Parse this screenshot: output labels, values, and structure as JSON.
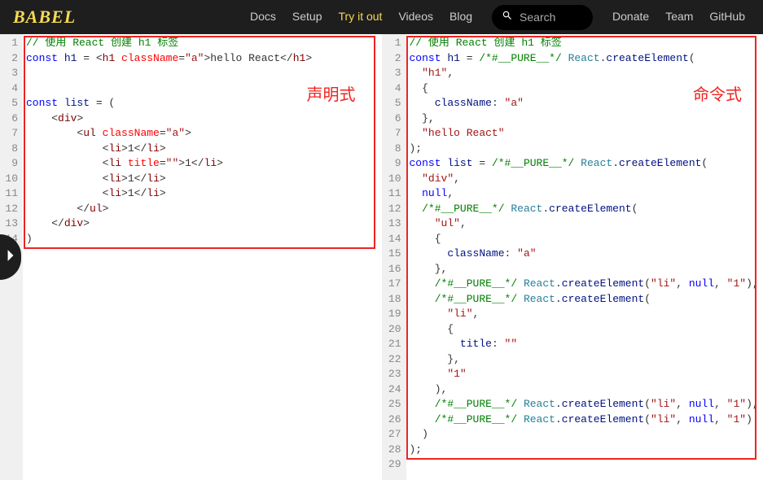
{
  "header": {
    "logo": "BABEL",
    "nav": [
      {
        "label": "Docs",
        "active": false
      },
      {
        "label": "Setup",
        "active": false
      },
      {
        "label": "Try it out",
        "active": true
      },
      {
        "label": "Videos",
        "active": false
      },
      {
        "label": "Blog",
        "active": false
      }
    ],
    "search_placeholder": "Search",
    "nav2": [
      {
        "label": "Donate"
      },
      {
        "label": "Team"
      },
      {
        "label": "GitHub"
      }
    ]
  },
  "annotations": {
    "left": "声明式",
    "right": "命令式"
  },
  "left_pane": {
    "line_count": 15,
    "lines": [
      [
        {
          "t": "// 使用 React 创建 h1 标签",
          "c": "comment"
        }
      ],
      [
        {
          "t": "const ",
          "c": "keyword"
        },
        {
          "t": "h1",
          "c": "var"
        },
        {
          "t": " = ",
          "c": "punct"
        },
        {
          "t": "<",
          "c": "punct"
        },
        {
          "t": "h1 ",
          "c": "tag"
        },
        {
          "t": "className",
          "c": "attr"
        },
        {
          "t": "=",
          "c": "punct"
        },
        {
          "t": "\"a\"",
          "c": "string"
        },
        {
          "t": ">",
          "c": "punct"
        },
        {
          "t": "hello React",
          "c": "text"
        },
        {
          "t": "</",
          "c": "punct"
        },
        {
          "t": "h1",
          "c": "tag"
        },
        {
          "t": ">",
          "c": "punct"
        }
      ],
      [],
      [],
      [
        {
          "t": "const ",
          "c": "keyword"
        },
        {
          "t": "list",
          "c": "var"
        },
        {
          "t": " = (",
          "c": "punct"
        }
      ],
      [
        {
          "t": "    ",
          "c": "punct"
        },
        {
          "t": "<",
          "c": "punct"
        },
        {
          "t": "div",
          "c": "tag"
        },
        {
          "t": ">",
          "c": "punct"
        }
      ],
      [
        {
          "t": "        ",
          "c": "punct"
        },
        {
          "t": "<",
          "c": "punct"
        },
        {
          "t": "ul ",
          "c": "tag"
        },
        {
          "t": "className",
          "c": "attr"
        },
        {
          "t": "=",
          "c": "punct"
        },
        {
          "t": "\"a\"",
          "c": "string"
        },
        {
          "t": ">",
          "c": "punct"
        }
      ],
      [
        {
          "t": "            ",
          "c": "punct"
        },
        {
          "t": "<",
          "c": "punct"
        },
        {
          "t": "li",
          "c": "tag"
        },
        {
          "t": ">",
          "c": "punct"
        },
        {
          "t": "1",
          "c": "text"
        },
        {
          "t": "</",
          "c": "punct"
        },
        {
          "t": "li",
          "c": "tag"
        },
        {
          "t": ">",
          "c": "punct"
        }
      ],
      [
        {
          "t": "            ",
          "c": "punct"
        },
        {
          "t": "<",
          "c": "punct"
        },
        {
          "t": "li ",
          "c": "tag"
        },
        {
          "t": "title",
          "c": "attr"
        },
        {
          "t": "=",
          "c": "punct"
        },
        {
          "t": "\"\"",
          "c": "string"
        },
        {
          "t": ">",
          "c": "punct"
        },
        {
          "t": "1",
          "c": "text"
        },
        {
          "t": "</",
          "c": "punct"
        },
        {
          "t": "li",
          "c": "tag"
        },
        {
          "t": ">",
          "c": "punct"
        }
      ],
      [
        {
          "t": "            ",
          "c": "punct"
        },
        {
          "t": "<",
          "c": "punct"
        },
        {
          "t": "li",
          "c": "tag"
        },
        {
          "t": ">",
          "c": "punct"
        },
        {
          "t": "1",
          "c": "text"
        },
        {
          "t": "</",
          "c": "punct"
        },
        {
          "t": "li",
          "c": "tag"
        },
        {
          "t": ">",
          "c": "punct"
        }
      ],
      [
        {
          "t": "            ",
          "c": "punct"
        },
        {
          "t": "<",
          "c": "punct"
        },
        {
          "t": "li",
          "c": "tag"
        },
        {
          "t": ">",
          "c": "punct"
        },
        {
          "t": "1",
          "c": "text"
        },
        {
          "t": "</",
          "c": "punct"
        },
        {
          "t": "li",
          "c": "tag"
        },
        {
          "t": ">",
          "c": "punct"
        }
      ],
      [
        {
          "t": "        ",
          "c": "punct"
        },
        {
          "t": "</",
          "c": "punct"
        },
        {
          "t": "ul",
          "c": "tag"
        },
        {
          "t": ">",
          "c": "punct"
        }
      ],
      [
        {
          "t": "    ",
          "c": "punct"
        },
        {
          "t": "</",
          "c": "punct"
        },
        {
          "t": "div",
          "c": "tag"
        },
        {
          "t": ">",
          "c": "punct"
        }
      ],
      [
        {
          "t": ")",
          "c": "punct"
        }
      ],
      []
    ]
  },
  "right_pane": {
    "line_count": 29,
    "lines": [
      [
        {
          "t": "// 使用 React 创建 h1 标签",
          "c": "comment"
        }
      ],
      [
        {
          "t": "const ",
          "c": "keyword"
        },
        {
          "t": "h1",
          "c": "var"
        },
        {
          "t": " = ",
          "c": "punct"
        },
        {
          "t": "/*#__PURE__*/",
          "c": "comment"
        },
        {
          "t": " ",
          "c": "punct"
        },
        {
          "t": "React",
          "c": "obj"
        },
        {
          "t": ".",
          "c": "punct"
        },
        {
          "t": "createElement",
          "c": "prop"
        },
        {
          "t": "(",
          "c": "punct"
        }
      ],
      [
        {
          "t": "  ",
          "c": "punct"
        },
        {
          "t": "\"h1\"",
          "c": "string"
        },
        {
          "t": ",",
          "c": "punct"
        }
      ],
      [
        {
          "t": "  {",
          "c": "punct"
        }
      ],
      [
        {
          "t": "    ",
          "c": "punct"
        },
        {
          "t": "className",
          "c": "prop"
        },
        {
          "t": ": ",
          "c": "punct"
        },
        {
          "t": "\"a\"",
          "c": "string"
        }
      ],
      [
        {
          "t": "  },",
          "c": "punct"
        }
      ],
      [
        {
          "t": "  ",
          "c": "punct"
        },
        {
          "t": "\"hello React\"",
          "c": "string"
        }
      ],
      [
        {
          "t": ");",
          "c": "punct"
        }
      ],
      [
        {
          "t": "const ",
          "c": "keyword"
        },
        {
          "t": "list",
          "c": "var"
        },
        {
          "t": " = ",
          "c": "punct"
        },
        {
          "t": "/*#__PURE__*/",
          "c": "comment"
        },
        {
          "t": " ",
          "c": "punct"
        },
        {
          "t": "React",
          "c": "obj"
        },
        {
          "t": ".",
          "c": "punct"
        },
        {
          "t": "createElement",
          "c": "prop"
        },
        {
          "t": "(",
          "c": "punct"
        }
      ],
      [
        {
          "t": "  ",
          "c": "punct"
        },
        {
          "t": "\"div\"",
          "c": "string"
        },
        {
          "t": ",",
          "c": "punct"
        }
      ],
      [
        {
          "t": "  ",
          "c": "punct"
        },
        {
          "t": "null",
          "c": "keyword"
        },
        {
          "t": ",",
          "c": "punct"
        }
      ],
      [
        {
          "t": "  ",
          "c": "punct"
        },
        {
          "t": "/*#__PURE__*/",
          "c": "comment"
        },
        {
          "t": " ",
          "c": "punct"
        },
        {
          "t": "React",
          "c": "obj"
        },
        {
          "t": ".",
          "c": "punct"
        },
        {
          "t": "createElement",
          "c": "prop"
        },
        {
          "t": "(",
          "c": "punct"
        }
      ],
      [
        {
          "t": "    ",
          "c": "punct"
        },
        {
          "t": "\"ul\"",
          "c": "string"
        },
        {
          "t": ",",
          "c": "punct"
        }
      ],
      [
        {
          "t": "    {",
          "c": "punct"
        }
      ],
      [
        {
          "t": "      ",
          "c": "punct"
        },
        {
          "t": "className",
          "c": "prop"
        },
        {
          "t": ": ",
          "c": "punct"
        },
        {
          "t": "\"a\"",
          "c": "string"
        }
      ],
      [
        {
          "t": "    },",
          "c": "punct"
        }
      ],
      [
        {
          "t": "    ",
          "c": "punct"
        },
        {
          "t": "/*#__PURE__*/",
          "c": "comment"
        },
        {
          "t": " ",
          "c": "punct"
        },
        {
          "t": "React",
          "c": "obj"
        },
        {
          "t": ".",
          "c": "punct"
        },
        {
          "t": "createElement",
          "c": "prop"
        },
        {
          "t": "(",
          "c": "punct"
        },
        {
          "t": "\"li\"",
          "c": "string"
        },
        {
          "t": ", ",
          "c": "punct"
        },
        {
          "t": "null",
          "c": "keyword"
        },
        {
          "t": ", ",
          "c": "punct"
        },
        {
          "t": "\"1\"",
          "c": "string"
        },
        {
          "t": "),",
          "c": "punct"
        }
      ],
      [
        {
          "t": "    ",
          "c": "punct"
        },
        {
          "t": "/*#__PURE__*/",
          "c": "comment"
        },
        {
          "t": " ",
          "c": "punct"
        },
        {
          "t": "React",
          "c": "obj"
        },
        {
          "t": ".",
          "c": "punct"
        },
        {
          "t": "createElement",
          "c": "prop"
        },
        {
          "t": "(",
          "c": "punct"
        }
      ],
      [
        {
          "t": "      ",
          "c": "punct"
        },
        {
          "t": "\"li\"",
          "c": "string"
        },
        {
          "t": ",",
          "c": "punct"
        }
      ],
      [
        {
          "t": "      {",
          "c": "punct"
        }
      ],
      [
        {
          "t": "        ",
          "c": "punct"
        },
        {
          "t": "title",
          "c": "prop"
        },
        {
          "t": ": ",
          "c": "punct"
        },
        {
          "t": "\"\"",
          "c": "string"
        }
      ],
      [
        {
          "t": "      },",
          "c": "punct"
        }
      ],
      [
        {
          "t": "      ",
          "c": "punct"
        },
        {
          "t": "\"1\"",
          "c": "string"
        }
      ],
      [
        {
          "t": "    ),",
          "c": "punct"
        }
      ],
      [
        {
          "t": "    ",
          "c": "punct"
        },
        {
          "t": "/*#__PURE__*/",
          "c": "comment"
        },
        {
          "t": " ",
          "c": "punct"
        },
        {
          "t": "React",
          "c": "obj"
        },
        {
          "t": ".",
          "c": "punct"
        },
        {
          "t": "createElement",
          "c": "prop"
        },
        {
          "t": "(",
          "c": "punct"
        },
        {
          "t": "\"li\"",
          "c": "string"
        },
        {
          "t": ", ",
          "c": "punct"
        },
        {
          "t": "null",
          "c": "keyword"
        },
        {
          "t": ", ",
          "c": "punct"
        },
        {
          "t": "\"1\"",
          "c": "string"
        },
        {
          "t": "),",
          "c": "punct"
        }
      ],
      [
        {
          "t": "    ",
          "c": "punct"
        },
        {
          "t": "/*#__PURE__*/",
          "c": "comment"
        },
        {
          "t": " ",
          "c": "punct"
        },
        {
          "t": "React",
          "c": "obj"
        },
        {
          "t": ".",
          "c": "punct"
        },
        {
          "t": "createElement",
          "c": "prop"
        },
        {
          "t": "(",
          "c": "punct"
        },
        {
          "t": "\"li\"",
          "c": "string"
        },
        {
          "t": ", ",
          "c": "punct"
        },
        {
          "t": "null",
          "c": "keyword"
        },
        {
          "t": ", ",
          "c": "punct"
        },
        {
          "t": "\"1\"",
          "c": "string"
        },
        {
          "t": ")",
          "c": "punct"
        }
      ],
      [
        {
          "t": "  )",
          "c": "punct"
        }
      ],
      [
        {
          "t": ");",
          "c": "punct"
        }
      ],
      []
    ]
  }
}
